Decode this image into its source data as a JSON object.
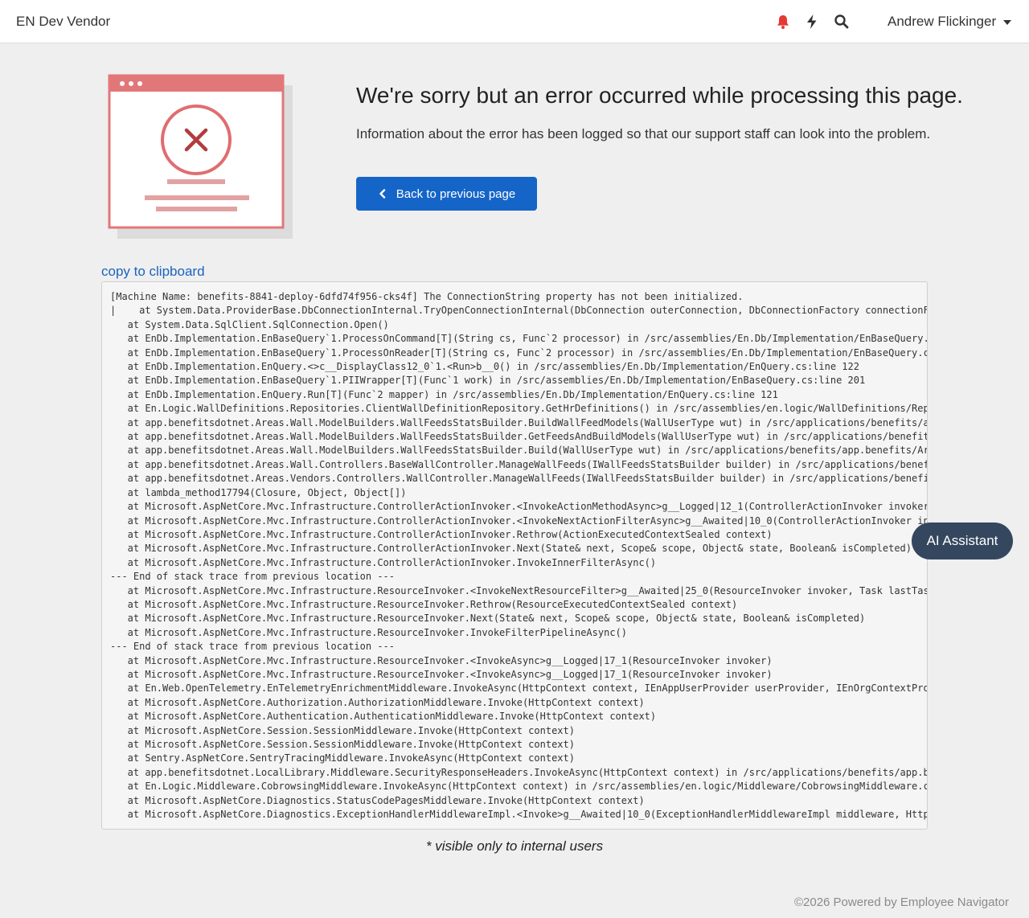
{
  "header": {
    "brand": "EN Dev Vendor",
    "icons": [
      "bell-icon",
      "bolt-icon",
      "search-icon"
    ],
    "user_name": "Andrew Flickinger",
    "bell_color": "#e53935"
  },
  "error": {
    "heading": "We're sorry but an error occurred while processing this page.",
    "message": "Information about the error has been logged so that our support staff can look into the problem.",
    "back_button": "Back to previous page"
  },
  "copy_link": "copy to clipboard",
  "stack_trace": [
    "[Machine Name: benefits-8841-deploy-6dfd74f956-cks4f] The ConnectionString property has not been initialized.",
    "|    at System.Data.ProviderBase.DbConnectionInternal.TryOpenConnectionInternal(DbConnection outerConnection, DbConnectionFactory connectionFa",
    "   at System.Data.SqlClient.SqlConnection.Open()",
    "   at EnDb.Implementation.EnBaseQuery`1.ProcessOnCommand[T](String cs, Func`2 processor) in /src/assemblies/En.Db/Implementation/EnBaseQuery.c",
    "   at EnDb.Implementation.EnBaseQuery`1.ProcessOnReader[T](String cs, Func`2 processor) in /src/assemblies/En.Db/Implementation/EnBaseQuery.cs",
    "   at EnDb.Implementation.EnQuery.<>c__DisplayClass12_0`1.<Run>b__0() in /src/assemblies/En.Db/Implementation/EnQuery.cs:line 122",
    "   at EnDb.Implementation.EnBaseQuery`1.PIIWrapper[T](Func`1 work) in /src/assemblies/En.Db/Implementation/EnBaseQuery.cs:line 201",
    "   at EnDb.Implementation.EnQuery.Run[T](Func`2 mapper) in /src/assemblies/En.Db/Implementation/EnQuery.cs:line 121",
    "   at En.Logic.WallDefinitions.Repositories.ClientWallDefinitionRepository.GetHrDefinitions() in /src/assemblies/en.logic/WallDefinitions/Repo",
    "   at app.benefitsdotnet.Areas.Wall.ModelBuilders.WallFeedsStatsBuilder.BuildWallFeedModels(WallUserType wut) in /src/applications/benefits/a",
    "   at app.benefitsdotnet.Areas.Wall.ModelBuilders.WallFeedsStatsBuilder.GetFeedsAndBuildModels(WallUserType wut) in /src/applications/benefit",
    "   at app.benefitsdotnet.Areas.Wall.ModelBuilders.WallFeedsStatsBuilder.Build(WallUserType wut) in /src/applications/benefits/app.benefits/Are",
    "   at app.benefitsdotnet.Areas.Wall.Controllers.BaseWallController.ManageWallFeeds(IWallFeedsStatsBuilder builder) in /src/applications/benef",
    "   at app.benefitsdotnet.Areas.Vendors.Controllers.WallController.ManageWallFeeds(IWallFeedsStatsBuilder builder) in /src/applications/benefi",
    "   at lambda_method17794(Closure, Object, Object[])",
    "   at Microsoft.AspNetCore.Mvc.Infrastructure.ControllerActionInvoker.<InvokeActionMethodAsync>g__Logged|12_1(ControllerActionInvoker invoker",
    "   at Microsoft.AspNetCore.Mvc.Infrastructure.ControllerActionInvoker.<InvokeNextActionFilterAsync>g__Awaited|10_0(ControllerActionInvoker in",
    "   at Microsoft.AspNetCore.Mvc.Infrastructure.ControllerActionInvoker.Rethrow(ActionExecutedContextSealed context)",
    "   at Microsoft.AspNetCore.Mvc.Infrastructure.ControllerActionInvoker.Next(State& next, Scope& scope, Object& state, Boolean& isCompleted)",
    "   at Microsoft.AspNetCore.Mvc.Infrastructure.ControllerActionInvoker.InvokeInnerFilterAsync()",
    "--- End of stack trace from previous location ---",
    "   at Microsoft.AspNetCore.Mvc.Infrastructure.ResourceInvoker.<InvokeNextResourceFilter>g__Awaited|25_0(ResourceInvoker invoker, Task lastTas",
    "   at Microsoft.AspNetCore.Mvc.Infrastructure.ResourceInvoker.Rethrow(ResourceExecutedContextSealed context)",
    "   at Microsoft.AspNetCore.Mvc.Infrastructure.ResourceInvoker.Next(State& next, Scope& scope, Object& state, Boolean& isCompleted)",
    "   at Microsoft.AspNetCore.Mvc.Infrastructure.ResourceInvoker.InvokeFilterPipelineAsync()",
    "--- End of stack trace from previous location ---",
    "   at Microsoft.AspNetCore.Mvc.Infrastructure.ResourceInvoker.<InvokeAsync>g__Logged|17_1(ResourceInvoker invoker)",
    "   at Microsoft.AspNetCore.Mvc.Infrastructure.ResourceInvoker.<InvokeAsync>g__Logged|17_1(ResourceInvoker invoker)",
    "   at En.Web.OpenTelemetry.EnTelemetryEnrichmentMiddleware.InvokeAsync(HttpContext context, IEnAppUserProvider userProvider, IEnOrgContextPro",
    "   at Microsoft.AspNetCore.Authorization.AuthorizationMiddleware.Invoke(HttpContext context)",
    "   at Microsoft.AspNetCore.Authentication.AuthenticationMiddleware.Invoke(HttpContext context)",
    "   at Microsoft.AspNetCore.Session.SessionMiddleware.Invoke(HttpContext context)",
    "   at Microsoft.AspNetCore.Session.SessionMiddleware.Invoke(HttpContext context)",
    "   at Sentry.AspNetCore.SentryTracingMiddleware.InvokeAsync(HttpContext context)",
    "   at app.benefitsdotnet.LocalLibrary.Middleware.SecurityResponseHeaders.InvokeAsync(HttpContext context) in /src/applications/benefits/app.be",
    "   at En.Logic.Middleware.CobrowsingMiddleware.InvokeAsync(HttpContext context) in /src/assemblies/en.logic/Middleware/CobrowsingMiddleware.c",
    "   at Microsoft.AspNetCore.Diagnostics.StatusCodePagesMiddleware.Invoke(HttpContext context)",
    "   at Microsoft.AspNetCore.Diagnostics.ExceptionHandlerMiddlewareImpl.<Invoke>g__Awaited|10_0(ExceptionHandlerMiddlewareImpl middleware, Http"
  ],
  "ai_assistant": "AI Assistant",
  "internal_note": "* visible only to internal users",
  "footer": "©2026 Powered by Employee Navigator",
  "colors": {
    "primary": "#1565c8",
    "error_accent": "#e57373",
    "ai_button": "#34475f"
  }
}
